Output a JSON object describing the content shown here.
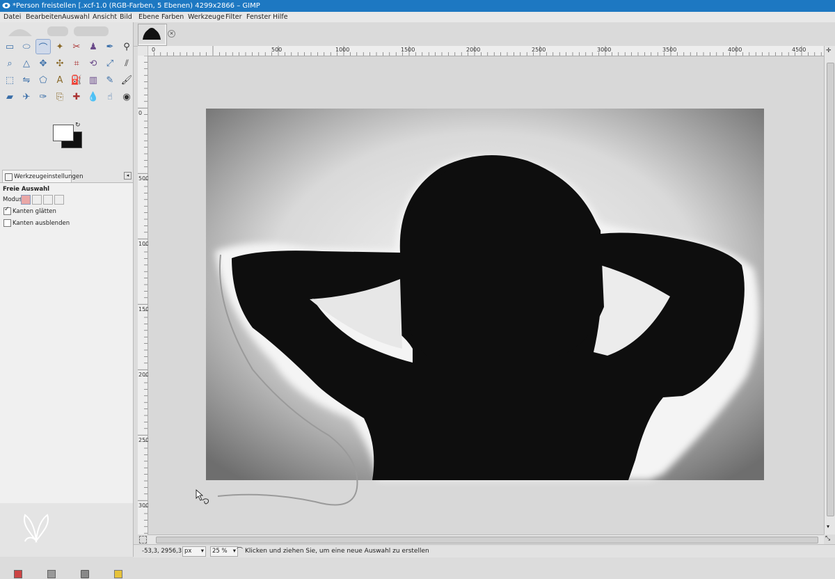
{
  "window": {
    "title": "*Person freistellen [.xcf-1.0 (RGB-Farben, 5 Ebenen) 4299x2866 – GIMP"
  },
  "menu": [
    "Datei",
    "Bearbeiten",
    "Auswahl",
    "Ansicht",
    "Bild",
    "Ebene",
    "Farben",
    "Werkzeuge",
    "Filter",
    "Fenster",
    "Hilfe"
  ],
  "toolbox": {
    "tools": [
      {
        "name": "rect-select-icon",
        "active": false
      },
      {
        "name": "ellipse-select-icon",
        "active": false
      },
      {
        "name": "free-select-icon",
        "active": true
      },
      {
        "name": "fuzzy-select-icon",
        "active": false
      },
      {
        "name": "scissors-select-icon",
        "active": false
      },
      {
        "name": "foreground-select-icon",
        "active": false
      },
      {
        "name": "paths-icon",
        "active": false
      },
      {
        "name": "color-picker-icon",
        "active": false
      },
      {
        "name": "zoom-icon",
        "active": false
      },
      {
        "name": "measure-icon",
        "active": false
      },
      {
        "name": "move-icon",
        "active": false
      },
      {
        "name": "align-icon",
        "active": false
      },
      {
        "name": "crop-icon",
        "active": false
      },
      {
        "name": "rotate-icon",
        "active": false
      },
      {
        "name": "scale-icon",
        "active": false
      },
      {
        "name": "shear-icon",
        "active": false
      },
      {
        "name": "perspective-icon",
        "active": false
      },
      {
        "name": "flip-icon",
        "active": false
      },
      {
        "name": "cage-transform-icon",
        "active": false
      },
      {
        "name": "text-icon",
        "active": false
      },
      {
        "name": "bucket-fill-icon",
        "active": false
      },
      {
        "name": "blend-icon",
        "active": false
      },
      {
        "name": "pencil-icon",
        "active": false
      },
      {
        "name": "paintbrush-icon",
        "active": false
      },
      {
        "name": "eraser-icon",
        "active": false
      },
      {
        "name": "airbrush-icon",
        "active": false
      },
      {
        "name": "ink-icon",
        "active": false
      },
      {
        "name": "clone-icon",
        "active": false
      },
      {
        "name": "heal-icon",
        "active": false
      },
      {
        "name": "blur-icon",
        "active": false
      },
      {
        "name": "smudge-icon",
        "active": false
      },
      {
        "name": "dodge-burn-icon",
        "active": false
      }
    ]
  },
  "tool_options": {
    "tab_label": "Werkzeugeinstellungen",
    "tool_name": "Freie Auswahl",
    "mode_label": "Modus:",
    "antialias_label": "Kanten glätten",
    "antialias_checked": true,
    "feather_label": "Kanten ausblenden",
    "feather_checked": false
  },
  "ruler": {
    "h_labels": [
      "0",
      "500",
      "1000",
      "1500",
      "2000",
      "2500",
      "3000",
      "3500",
      "4000",
      "4500"
    ],
    "v_labels": [
      "0",
      "500",
      "1000",
      "1500",
      "2000",
      "2500",
      "3000"
    ]
  },
  "status": {
    "coords": "-53,3, 2956,3",
    "unit": "px",
    "zoom": "25 %",
    "message": "Klicken und ziehen Sie, um eine neue Auswahl zu erstellen"
  },
  "colors": {
    "titlebar": "#1d78c2",
    "silhouette": "#0e0e0e"
  }
}
